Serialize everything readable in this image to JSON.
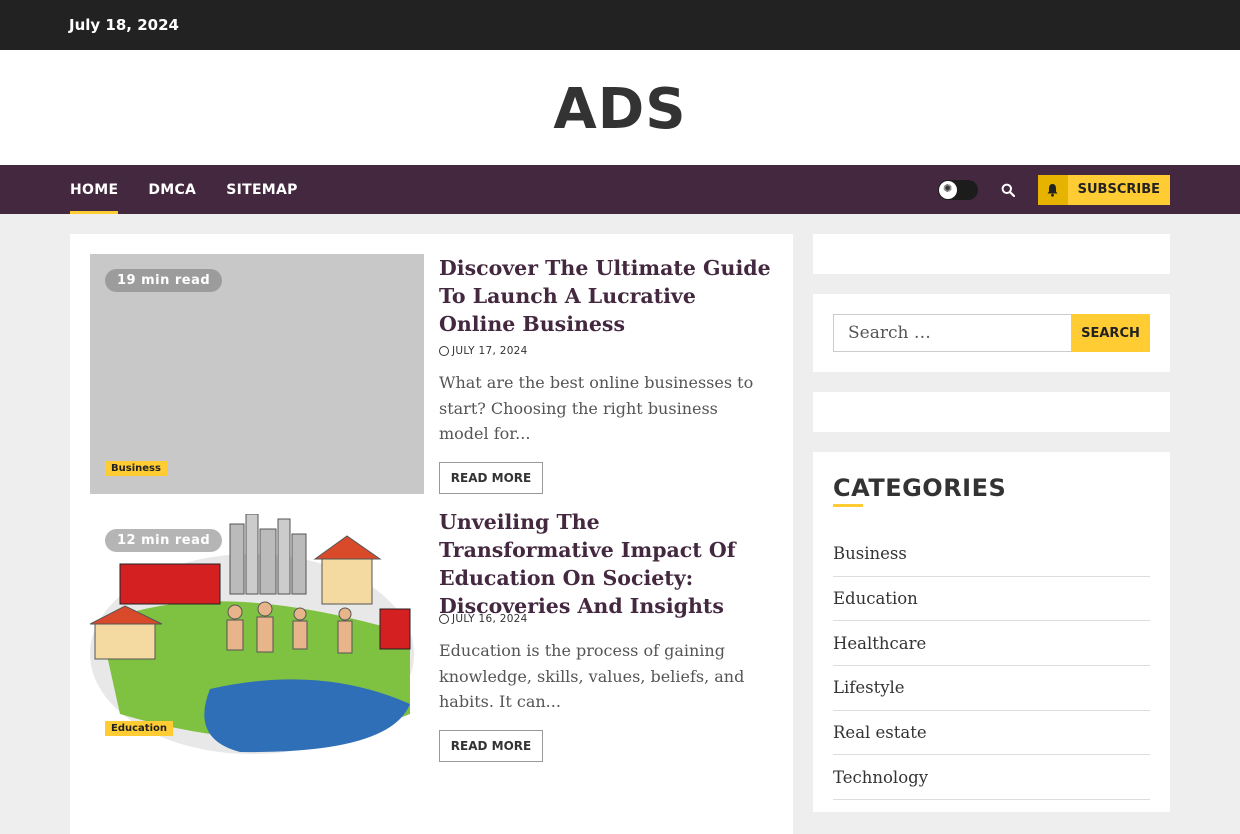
{
  "topbar": {
    "date": "July 18, 2024"
  },
  "site": {
    "title": "ADS"
  },
  "nav": {
    "items": [
      {
        "label": "HOME",
        "active": true
      },
      {
        "label": "DMCA",
        "active": false
      },
      {
        "label": "SITEMAP",
        "active": false
      }
    ],
    "subscribe_label": "SUBSCRIBE"
  },
  "posts": [
    {
      "read_time": "19 min read",
      "category": "Business",
      "title": "Discover The Ultimate Guide To Launch A Lucrative Online Business",
      "date": "JULY 17, 2024",
      "excerpt": "What are the best online businesses to start? Choosing the right business model for...",
      "read_more": "READ MORE"
    },
    {
      "read_time": "12 min read",
      "category": "Education",
      "title": "Unveiling The Transformative Impact Of Education On Society: Discoveries And Insights",
      "date": "JULY 16, 2024",
      "excerpt": "Education is the process of gaining knowledge, skills, values, beliefs, and habits. It can...",
      "read_more": "READ MORE"
    }
  ],
  "sidebar": {
    "search": {
      "placeholder": "Search …",
      "button": "SEARCH"
    },
    "categories": {
      "title": "CATEGORIES",
      "items": [
        "Business",
        "Education",
        "Healthcare",
        "Lifestyle",
        "Real estate",
        "Technology"
      ]
    }
  },
  "colors": {
    "accent": "#ffcc33",
    "nav_bg": "#43283f",
    "topbar_bg": "#222222"
  },
  "icons": {
    "theme_toggle": "sun-icon",
    "search": "search-icon",
    "subscribe": "bell-icon",
    "date": "clock-icon"
  }
}
